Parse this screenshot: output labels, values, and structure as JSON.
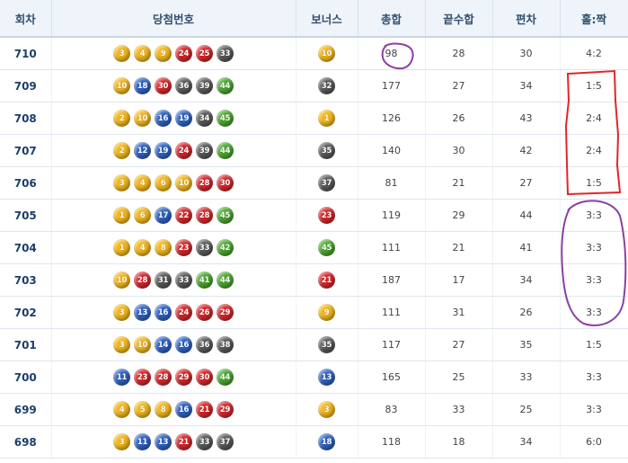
{
  "headers": [
    "회차",
    "당첨번호",
    "보너스",
    "총합",
    "끝수합",
    "편차",
    "홀:짝"
  ],
  "colors": {
    "y": "#f3b71a",
    "b": "#2e63c4",
    "r": "#d8262a",
    "g": "#595959",
    "gr": "#4aa82c",
    "mark_red": "#e0262b",
    "mark_purple": "#8c3fa3"
  },
  "rows": [
    {
      "draw": "710",
      "nums": [
        "3",
        "4",
        "9",
        "24",
        "25",
        "33"
      ],
      "bonus": "10",
      "sum": "98",
      "last": "28",
      "dev": "30",
      "oe": "4:2"
    },
    {
      "draw": "709",
      "nums": [
        "10",
        "18",
        "30",
        "36",
        "39",
        "44"
      ],
      "bonus": "32",
      "sum": "177",
      "last": "27",
      "dev": "34",
      "oe": "1:5"
    },
    {
      "draw": "708",
      "nums": [
        "2",
        "10",
        "16",
        "19",
        "34",
        "45"
      ],
      "bonus": "1",
      "sum": "126",
      "last": "26",
      "dev": "43",
      "oe": "2:4"
    },
    {
      "draw": "707",
      "nums": [
        "2",
        "12",
        "19",
        "24",
        "39",
        "44"
      ],
      "bonus": "35",
      "sum": "140",
      "last": "30",
      "dev": "42",
      "oe": "2:4"
    },
    {
      "draw": "706",
      "nums": [
        "3",
        "4",
        "6",
        "10",
        "28",
        "30"
      ],
      "bonus": "37",
      "sum": "81",
      "last": "21",
      "dev": "27",
      "oe": "1:5"
    },
    {
      "draw": "705",
      "nums": [
        "1",
        "6",
        "17",
        "22",
        "28",
        "45"
      ],
      "bonus": "23",
      "sum": "119",
      "last": "29",
      "dev": "44",
      "oe": "3:3"
    },
    {
      "draw": "704",
      "nums": [
        "1",
        "4",
        "8",
        "23",
        "33",
        "42"
      ],
      "bonus": "45",
      "sum": "111",
      "last": "21",
      "dev": "41",
      "oe": "3:3"
    },
    {
      "draw": "703",
      "nums": [
        "10",
        "28",
        "31",
        "33",
        "41",
        "44"
      ],
      "bonus": "21",
      "sum": "187",
      "last": "17",
      "dev": "34",
      "oe": "3:3"
    },
    {
      "draw": "702",
      "nums": [
        "3",
        "13",
        "16",
        "24",
        "26",
        "29"
      ],
      "bonus": "9",
      "sum": "111",
      "last": "31",
      "dev": "26",
      "oe": "3:3"
    },
    {
      "draw": "701",
      "nums": [
        "3",
        "10",
        "14",
        "16",
        "36",
        "38"
      ],
      "bonus": "35",
      "sum": "117",
      "last": "27",
      "dev": "35",
      "oe": "1:5"
    },
    {
      "draw": "700",
      "nums": [
        "11",
        "23",
        "28",
        "29",
        "30",
        "44"
      ],
      "bonus": "13",
      "sum": "165",
      "last": "25",
      "dev": "33",
      "oe": "3:3"
    },
    {
      "draw": "699",
      "nums": [
        "4",
        "5",
        "8",
        "16",
        "21",
        "29"
      ],
      "bonus": "3",
      "sum": "83",
      "last": "33",
      "dev": "25",
      "oe": "3:3"
    },
    {
      "draw": "698",
      "nums": [
        "3",
        "11",
        "13",
        "21",
        "33",
        "37"
      ],
      "bonus": "18",
      "sum": "118",
      "last": "18",
      "dev": "34",
      "oe": "6:0"
    }
  ]
}
